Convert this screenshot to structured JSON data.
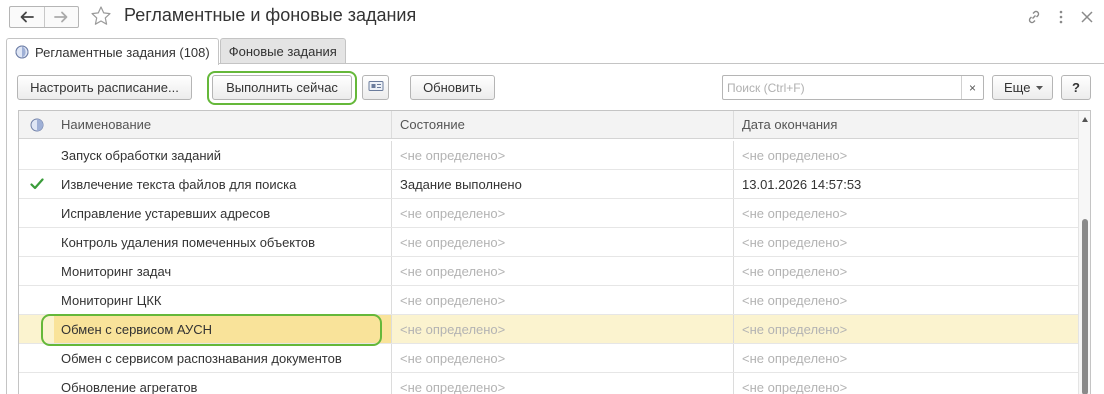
{
  "window": {
    "title": "Регламентные и фоновые задания"
  },
  "icons": {
    "back": "arrow-left-icon",
    "forward": "arrow-right-icon",
    "favorite": "star-icon",
    "link": "link-icon",
    "more": "more-vertical-icon",
    "close": "close-icon",
    "schedule_tab": "globe-clock-icon",
    "settings": "card-settings-icon",
    "done": "checkmark-icon"
  },
  "colors": {
    "highlight_ring": "#65b83a",
    "selected_row": "#fbf3cf",
    "selected_cell": "#f9e39a",
    "check": "#3a9c3a"
  },
  "tabs": [
    {
      "label": "Регламентные задания (108)",
      "active": true
    },
    {
      "label": "Фоновые задания",
      "active": false
    }
  ],
  "toolbar": {
    "configure_schedule": "Настроить расписание...",
    "run_now": "Выполнить сейчас",
    "refresh": "Обновить",
    "search_placeholder": "Поиск (Ctrl+F)",
    "search_clear": "×",
    "more": "Еще",
    "help": "?"
  },
  "table": {
    "columns": [
      "Наименование",
      "Состояние",
      "Дата окончания"
    ],
    "rows": [
      {
        "name": "Запуск обработки заданий",
        "state": "<не определено>",
        "end_date": "<не определено>",
        "done": false,
        "selected": false
      },
      {
        "name": "Извлечение текста файлов для поиска",
        "state": "Задание выполнено",
        "end_date": "13.01.2026 14:57:53",
        "done": true,
        "selected": false
      },
      {
        "name": "Исправление устаревших адресов",
        "state": "<не определено>",
        "end_date": "<не определено>",
        "done": false,
        "selected": false
      },
      {
        "name": "Контроль удаления помеченных объектов",
        "state": "<не определено>",
        "end_date": "<не определено>",
        "done": false,
        "selected": false
      },
      {
        "name": "Мониторинг задач",
        "state": "<не определено>",
        "end_date": "<не определено>",
        "done": false,
        "selected": false
      },
      {
        "name": "Мониторинг ЦКК",
        "state": "<не определено>",
        "end_date": "<не определено>",
        "done": false,
        "selected": false
      },
      {
        "name": "Обмен с сервисом АУСН",
        "state": "<не определено>",
        "end_date": "<не определено>",
        "done": false,
        "selected": true
      },
      {
        "name": "Обмен с сервисом распознавания документов",
        "state": "<не определено>",
        "end_date": "<не определено>",
        "done": false,
        "selected": false
      },
      {
        "name": "Обновление агрегатов",
        "state": "<не определено>",
        "end_date": "<не определено>",
        "done": false,
        "selected": false
      }
    ]
  }
}
